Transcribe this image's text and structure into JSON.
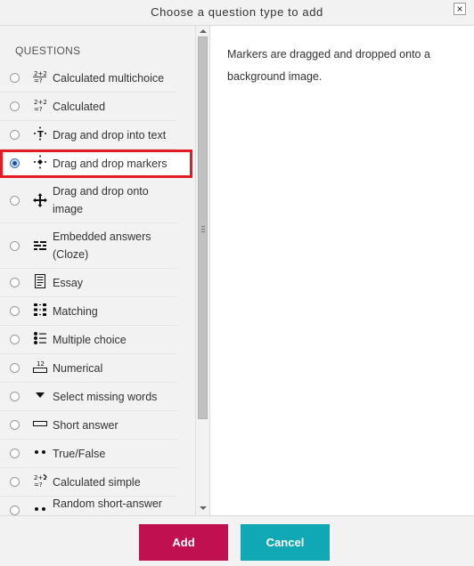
{
  "dialog": {
    "title": "Choose a question type to add",
    "close_glyph": "×"
  },
  "sidebar": {
    "heading": "QUESTIONS",
    "items": [
      {
        "label": "Calculated multichoice",
        "icon": "calc-multichoice-icon",
        "glyph": "²⁺²₌?"
      },
      {
        "label": "Calculated",
        "icon": "calculated-icon",
        "glyph": "²⁺²₌?"
      },
      {
        "label": "Drag and drop into text",
        "icon": "drag-drop-text-icon",
        "glyph": "·T·"
      },
      {
        "label": "Drag and drop markers",
        "icon": "drag-drop-markers-icon",
        "glyph": "·◆·"
      },
      {
        "label": "Drag and drop onto image",
        "icon": "drag-drop-image-icon",
        "glyph": "✛"
      },
      {
        "label": "Embedded answers (Cloze)",
        "icon": "cloze-icon",
        "glyph": "▬"
      },
      {
        "label": "Essay",
        "icon": "essay-icon",
        "glyph": "▤"
      },
      {
        "label": "Matching",
        "icon": "matching-icon",
        "glyph": "⋮⋮"
      },
      {
        "label": "Multiple choice",
        "icon": "multiple-choice-icon",
        "glyph": "⋮≡"
      },
      {
        "label": "Numerical",
        "icon": "numerical-icon",
        "glyph": "¹²"
      },
      {
        "label": "Select missing words",
        "icon": "select-missing-icon",
        "glyph": "▼"
      },
      {
        "label": "Short answer",
        "icon": "short-answer-icon",
        "glyph": "▭"
      },
      {
        "label": "True/False",
        "icon": "true-false-icon",
        "glyph": "••"
      },
      {
        "label": "Calculated simple",
        "icon": "calc-simple-icon",
        "glyph": "²⁺²₌?"
      },
      {
        "label": "Random short-answer",
        "icon": "random-short-icon",
        "glyph": "••"
      }
    ],
    "selected_index": 3
  },
  "detail": {
    "description": "Markers are dragged and dropped onto a background image."
  },
  "footer": {
    "add_label": "Add",
    "cancel_label": "Cancel"
  },
  "colors": {
    "add": "#c0104f",
    "cancel": "#11a8b5",
    "highlight": "#e51b24"
  }
}
